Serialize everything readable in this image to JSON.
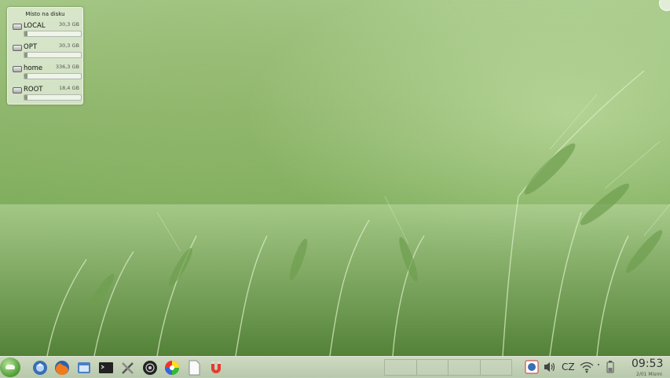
{
  "widget": {
    "title": "Místo na disku",
    "disks": [
      {
        "name": "LOCAL",
        "size": "30,3 GB",
        "used": 0.05
      },
      {
        "name": "OPT",
        "size": "30,3 GB",
        "used": 0.05
      },
      {
        "name": "home",
        "size": "336,3 GB",
        "used": 0.05
      },
      {
        "name": "ROOT",
        "size": "18,4 GB",
        "used": 0.05
      }
    ]
  },
  "taskbar": {
    "launchers": [
      "mageia-icon",
      "thunderbird-icon",
      "firefox-icon",
      "file-manager-icon",
      "terminal-icon",
      "system-settings-icon",
      "audio-player-icon",
      "color-picker-icon",
      "text-editor-icon",
      "magnet-icon"
    ],
    "tray": {
      "keyboard_layout": "CZ"
    },
    "clock": {
      "time": "09:53",
      "date": "2/01 Mismi"
    }
  }
}
